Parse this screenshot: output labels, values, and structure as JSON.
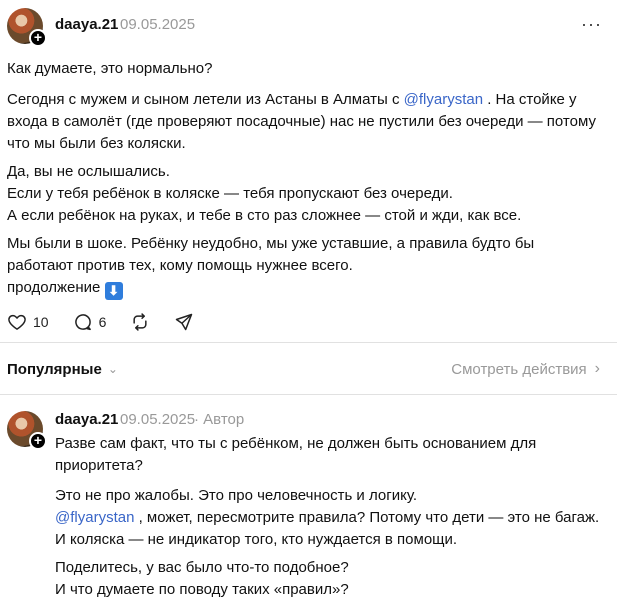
{
  "post": {
    "username": "daaya.21",
    "date": "09.05.2025",
    "more_icon": "ellipsis-icon",
    "title_line": "Как думаете, это нормально?",
    "p1_before": "Сегодня с мужем и сыном летели из Астаны в Алматы с ",
    "mention": "@flyarystan",
    "p1_after_line1": " . На стойке у",
    "p1_line2": "входа в самолёт (где проверяют посадочные) нас не пустили без очереди — потому",
    "p1_line3": "что мы были без коляски.",
    "p2_line1": "Да, вы не ослышались.",
    "p2_line2": "Если у тебя ребёнок в коляске — тебя пропускают без очереди.",
    "p2_line3": "А если ребёнок на руках, и тебе в сто раз сложнее — стой и жди, как все.",
    "p3_line1": "Мы были в шоке. Ребёнку неудобно, мы уже уставшие, а правила будто бы",
    "p3_line2": "работают против тех, кому помощь нужнее всего.",
    "p3_line3": "продолжение",
    "continue_emoji": "⬇",
    "likes": "10",
    "comments": "6"
  },
  "sortbar": {
    "sort_label": "Популярные",
    "view_activity": "Смотреть действия"
  },
  "reply": {
    "username": "daaya.21",
    "date": "09.05.2025",
    "separator": "·",
    "author_tag": "Автор",
    "q_line1": "Разве сам факт, что ты с ребёнком, не должен быть основанием для",
    "q_line2": "приоритета?",
    "p1_line1": "Это не про жалобы. Это про человечность и логику.",
    "mention": "@flyarystan",
    "p1_line2_after": " , может, пересмотрите правила? Потому что дети — это не багаж.",
    "p1_line3": "И коляска — не индикатор того, кто нуждается в помощи.",
    "p2_line1": "Поделитесь, у вас было что-то подобное?",
    "p2_line2": "И что думаете по поводу таких «правил»?"
  }
}
